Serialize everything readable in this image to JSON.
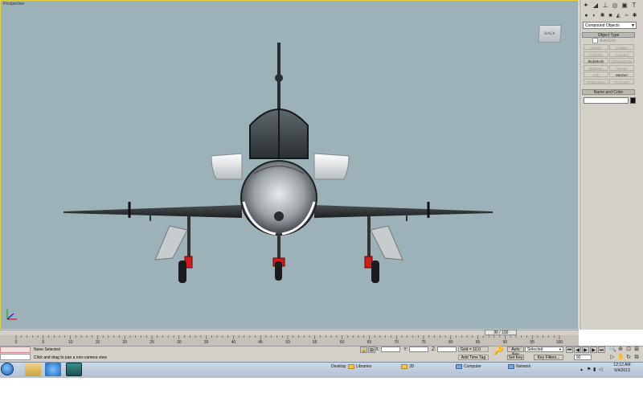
{
  "viewport": {
    "label": "Perspective",
    "viewcube_label": "BACK",
    "axis_labels": {
      "x": "x",
      "y": "y",
      "z": "z"
    },
    "border_color": "#e3d23c",
    "background_color": "#9db1b8"
  },
  "command_panel": {
    "tabs": [
      "create-icon",
      "modify-icon",
      "hierarchy-icon",
      "motion-icon",
      "display-icon",
      "utilities-icon"
    ],
    "subcategories": [
      "geometry-icon",
      "shapes-icon",
      "lights-icon",
      "cameras-icon",
      "helpers-icon",
      "spacewarps-icon",
      "systems-icon"
    ],
    "category_dropdown": "Compound Objects",
    "object_type_title": "Object Type",
    "autogrid_label": "AutoGrid",
    "object_buttons": [
      {
        "label": "Morph",
        "enabled": false
      },
      {
        "label": "Scatter",
        "enabled": false
      },
      {
        "label": "Conform",
        "enabled": false
      },
      {
        "label": "Connect",
        "enabled": false
      },
      {
        "label": "BlobMesh",
        "enabled": true
      },
      {
        "label": "ShapeMerge",
        "enabled": false
      },
      {
        "label": "Boolean",
        "enabled": false
      },
      {
        "label": "Terrain",
        "enabled": false
      },
      {
        "label": "Loft",
        "enabled": false
      },
      {
        "label": "Mesher",
        "enabled": true
      },
      {
        "label": "ProBoolean",
        "enabled": false
      },
      {
        "label": "ProCutter",
        "enabled": false
      }
    ],
    "name_color_title": "Name and Color",
    "name_value": "",
    "object_color": "#111111"
  },
  "timeline": {
    "slider_text": "90 / 100",
    "slider_position": 0.9,
    "ticks": [
      "0",
      "5",
      "10",
      "15",
      "20",
      "25",
      "30",
      "35",
      "40",
      "45",
      "50",
      "55",
      "60",
      "65",
      "70",
      "75",
      "80",
      "85",
      "90",
      "95",
      "100"
    ]
  },
  "status": {
    "selection": "None Selected",
    "prompt": "Click and drag to pan a non-camera view",
    "x_label": "X:",
    "y_label": "Y:",
    "z_label": "Z:",
    "x_value": "",
    "y_value": "",
    "z_value": "",
    "grid": "Grid = 10.0",
    "add_time_tag": "Add Time Tag",
    "auto_key": "Auto Key",
    "set_key": "Set Key",
    "key_mode": "Selected",
    "key_filters": "Key Filters...",
    "current_frame": "90"
  },
  "taskbar": {
    "items": [
      {
        "label": "Desktop",
        "type": "text"
      },
      {
        "label": "Libraries",
        "type": "folder"
      },
      {
        "label": "3D",
        "type": "folder"
      },
      {
        "label": "Computer",
        "type": "pc"
      },
      {
        "label": "Network",
        "type": "pc"
      }
    ],
    "time": "12:12 AM",
    "date": "5/4/2013"
  }
}
